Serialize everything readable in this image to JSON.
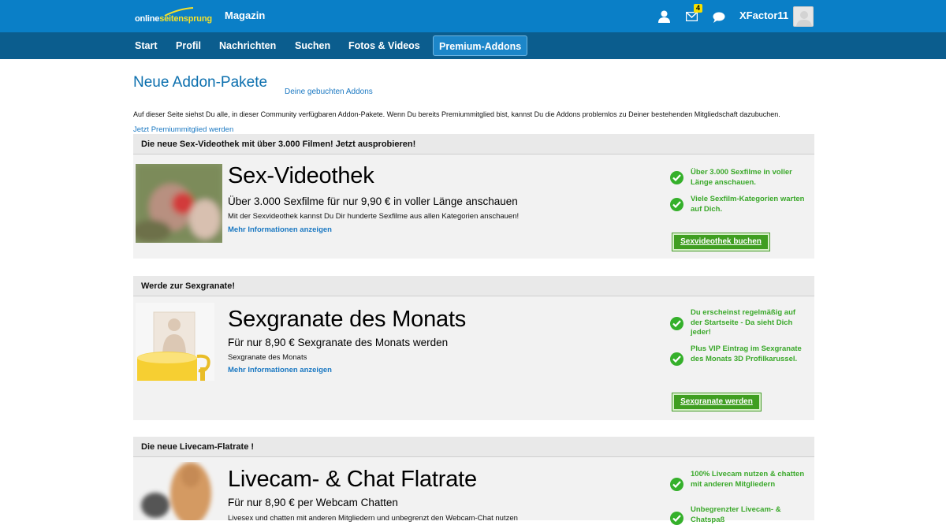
{
  "header": {
    "logo": {
      "part1": "online",
      "part2": "seitensprung"
    },
    "magazin": "Magazin",
    "mail_count": "4",
    "username": "XFactor11",
    "icons": [
      "user-icon",
      "mail-icon",
      "chat-bubble-icon"
    ]
  },
  "nav": {
    "items": [
      "Start",
      "Profil",
      "Nachrichten",
      "Suchen",
      "Fotos & Videos",
      "Premium-Addons"
    ],
    "active": "Premium-Addons"
  },
  "page": {
    "title": "Neue Addon-Pakete",
    "booked_link": "Deine gebuchten Addons",
    "intro": "Auf dieser Seite siehst Du alle, in dieser Community verfügbaren Addon-Pakete. Wenn Du bereits Premiummitglied bist, kannst Du die Addons problemlos zu Deiner bestehenden Mitgliedschaft dazubuchen.",
    "premium_link": "Jetzt Premiummitglied werden"
  },
  "packages": [
    {
      "header": "Die neue Sex-Videothek mit über 3.000 Filmen! Jetzt ausprobieren!",
      "name": "Sex-Videothek",
      "subtitle": "Über 3.000 Sexfilme für nur 9,90 € in voller Länge anschauen",
      "description": "Mit der Sexvideothek kannst Du Dir hunderte Sexfilme aus allen Kategorien anschauen!",
      "more": "Mehr Informationen anzeigen",
      "features": [
        "Über 3.000 Sexfilme in voller Länge anschauen.",
        "Viele Sexfilm-Kategorien warten auf Dich."
      ],
      "button": "Sexvideothek buchen"
    },
    {
      "header": "Werde zur Sexgranate!",
      "name": "Sexgranate des Monats",
      "subtitle": "Für nur 8,90 € Sexgranate des Monats werden",
      "description": "Sexgranate des Monats",
      "more": "Mehr Informationen anzeigen",
      "features": [
        "Du erscheinst regelmäßig auf der Startseite - Da sieht Dich jeder!",
        "Plus VIP Eintrag im Sexgranate des Monats 3D Profilkarussel."
      ],
      "button": "Sexgranate werden"
    },
    {
      "header": "Die neue Livecam-Flatrate !",
      "name": "Livecam- & Chat Flatrate",
      "subtitle": "Für nur 8,90 € per Webcam Chatten",
      "description": "Livesex und chatten mit anderen Mitgliedern und unbegrenzt den Webcam-Chat nutzen",
      "features": [
        "100% Livecam nutzen & chatten mit anderen Mitgliedern",
        "Unbegrenzter Livecam- & Chatspaß"
      ]
    }
  ],
  "colors": {
    "header_blue": "#0a7fc7",
    "nav_blue": "#0b5d8e",
    "title_blue": "#0b6fae",
    "feature_green": "#3aa82a",
    "button_green": "#3f9e21"
  }
}
